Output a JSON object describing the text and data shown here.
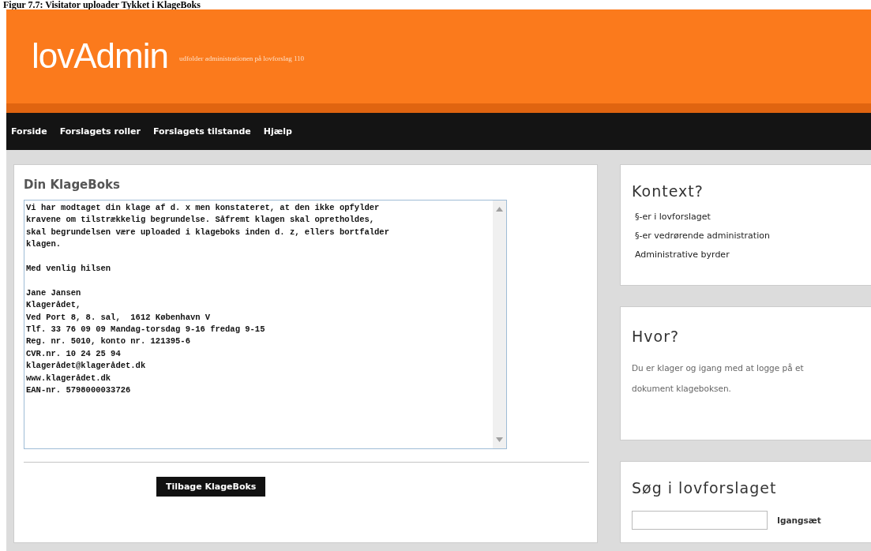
{
  "caption": "Figur 7.7: Visitator uploader Tykket i KlageBoks",
  "header": {
    "logo": "lovAdmin",
    "tagline": "udfolder administrationen på lovforslag 110"
  },
  "nav": [
    "Forside",
    "Forslagets roller",
    "Forslagets tilstande",
    "Hjælp"
  ],
  "main": {
    "title": "Din KlageBoks",
    "message": [
      [
        "Vi har modtaget din klage af d. x men konstateret, at den ikke opfylder",
        "kravene om tilstrækkelig begrundelse. Såfremt klagen skal opretholdes,",
        "skal begrundelsen være uploaded i klageboks inden d. z, ellers bortfalder",
        "klagen."
      ],
      [
        "Med venlig hilsen"
      ],
      [
        "Jane Jansen",
        "Klagerådet,",
        "Ved Port 8, 8. sal,  1612 København V",
        "Tlf. 33 76 09 09 Mandag-torsdag 9-16 fredag 9-15",
        "Reg. nr. 5010, konto nr. 121395-6",
        "CVR.nr. 10 24 25 94",
        "klagerådet@klagerådet.dk",
        "www.klagerådet.dk",
        "EAN-nr. 5798000033726"
      ]
    ],
    "button": "Tilbage KlageBoks"
  },
  "sidebar": [
    {
      "kind": "links",
      "title": "Kontext?",
      "links": [
        "§-er i lovforslaget",
        "§-er vedrørende administration",
        "Administrative byrder"
      ]
    },
    {
      "kind": "text",
      "title": "Hvor?",
      "text": "Du er klager og igang med at logge på et dokument klageboksen."
    },
    {
      "kind": "search",
      "title": "Søg i lovforslaget",
      "button": "Igangsæt"
    }
  ]
}
